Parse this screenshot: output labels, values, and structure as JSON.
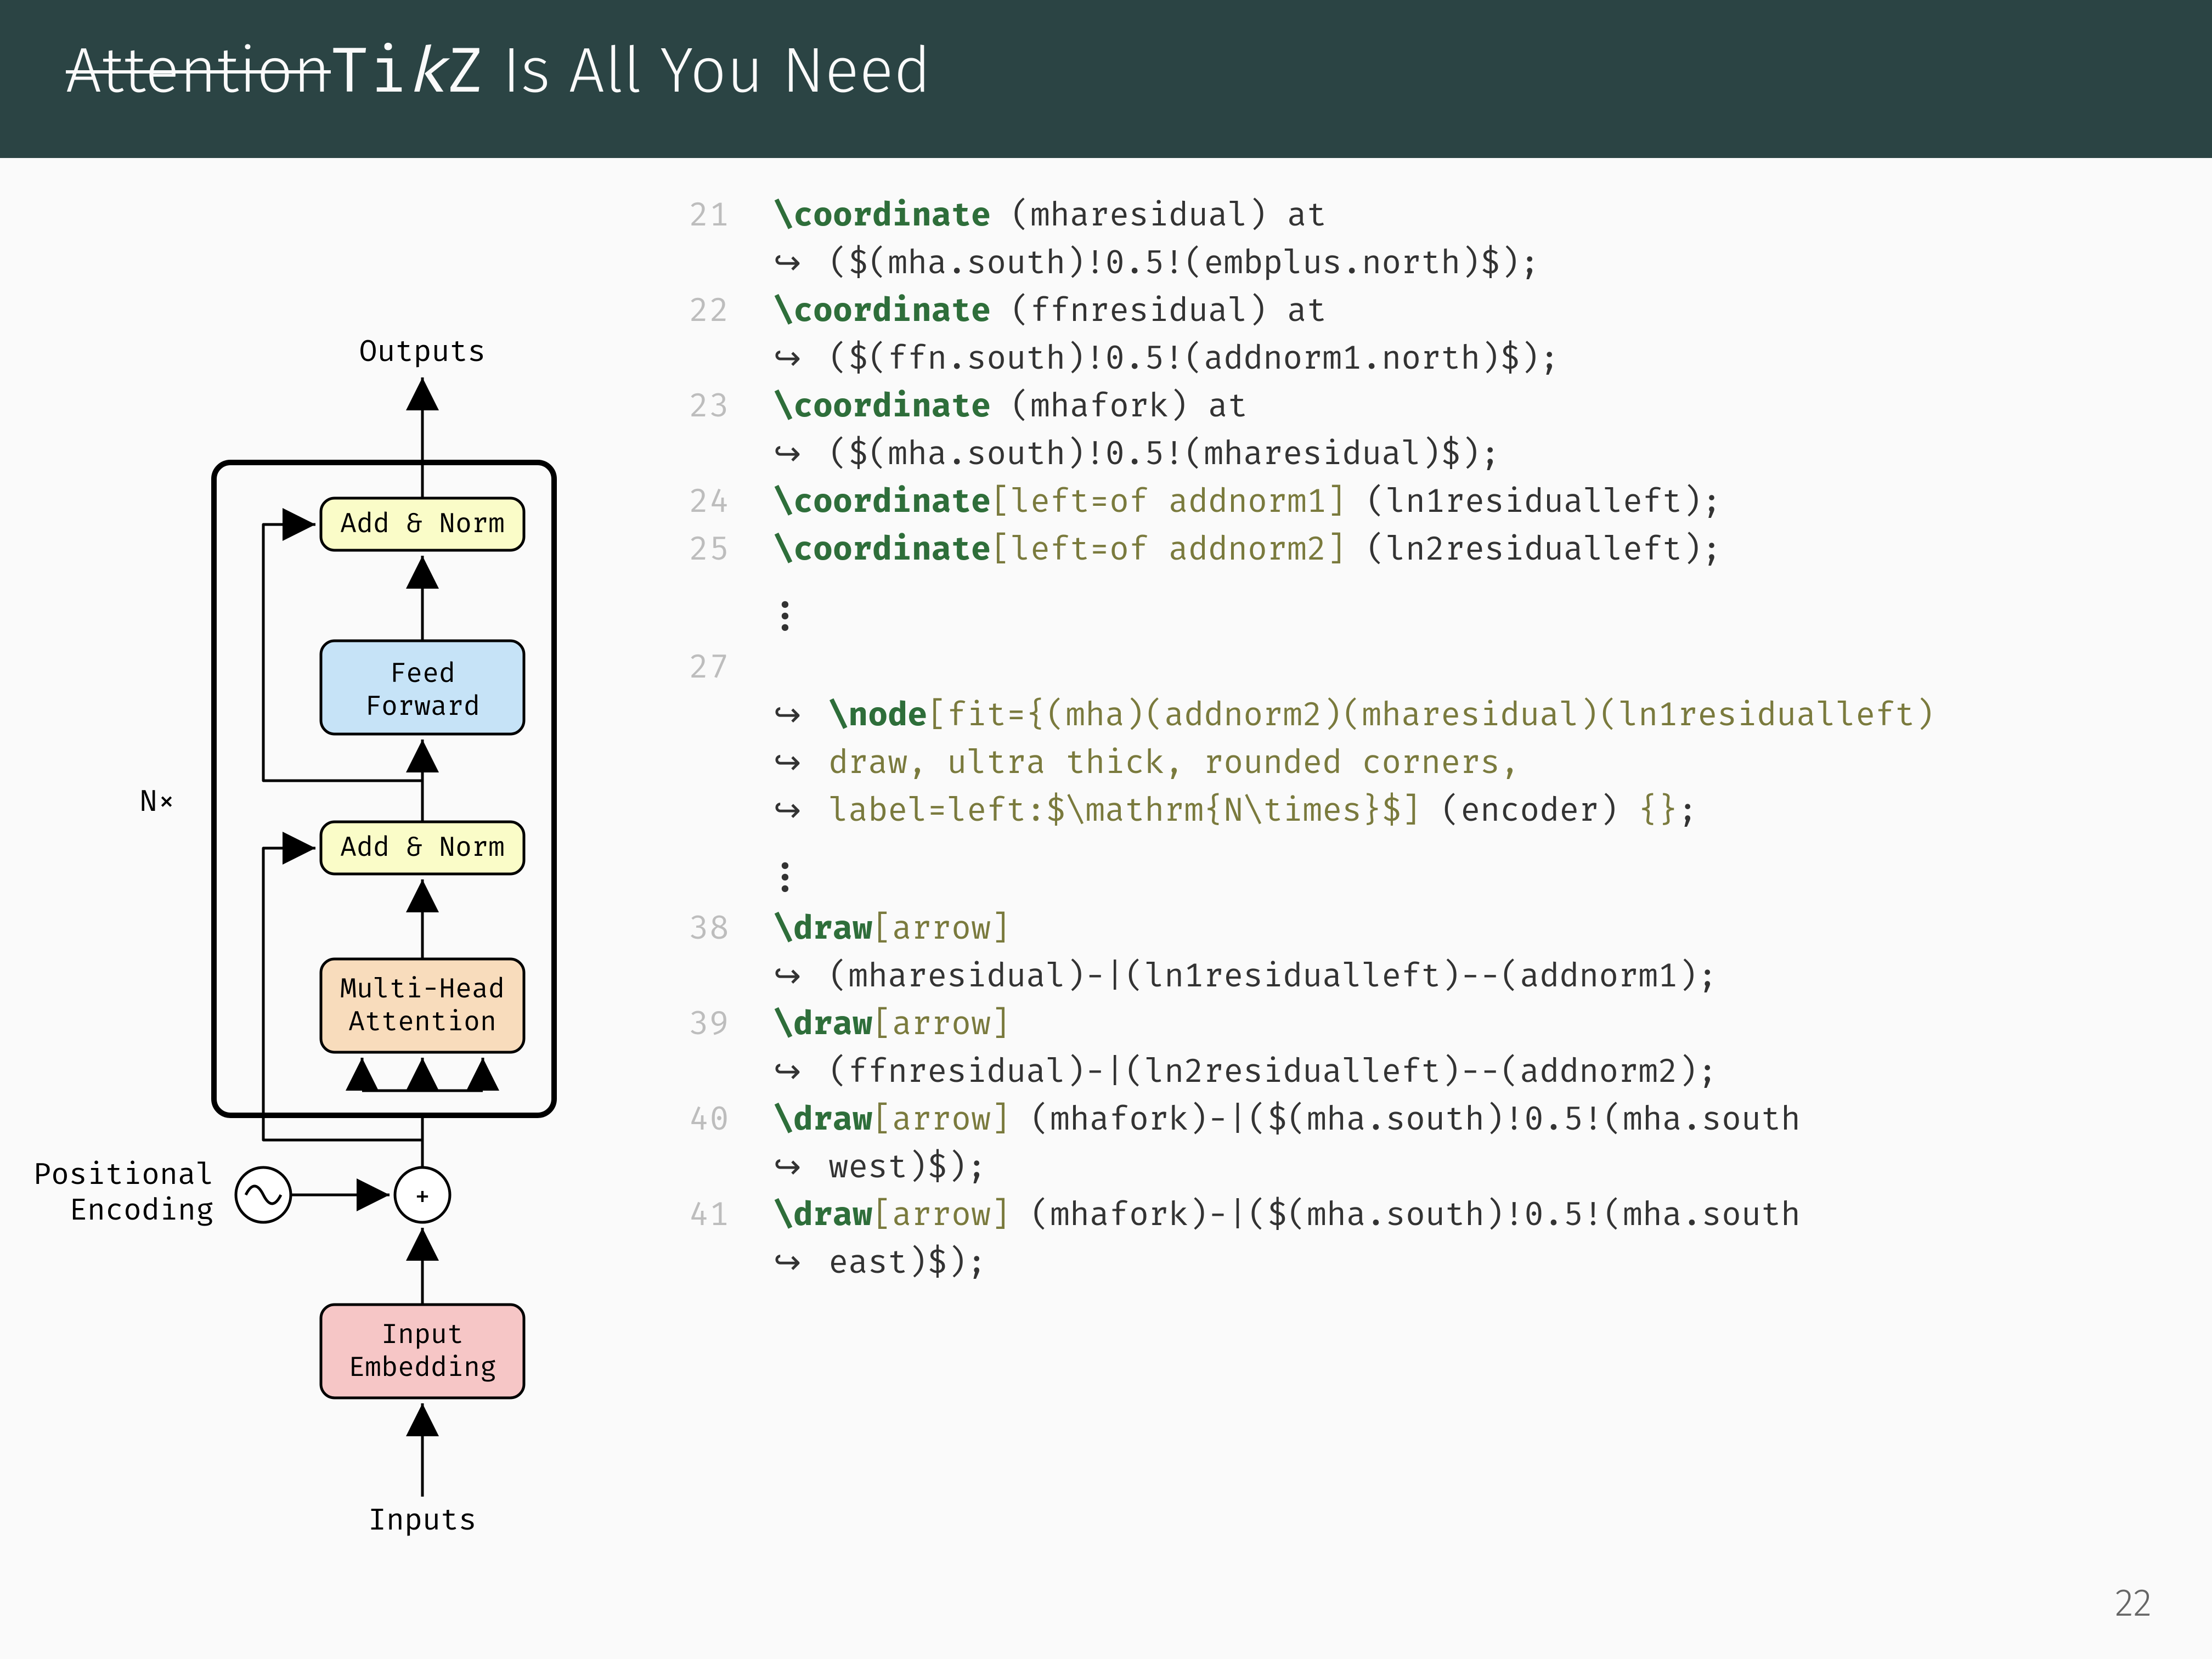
{
  "title": {
    "strike": "Attention",
    "tikz_pre": "Ti",
    "tikz_k": "k",
    "tikz_post": "Z",
    "rest": " Is All You Need"
  },
  "diagram": {
    "outputs": "Outputs",
    "addnorm2": "Add & Norm",
    "ffn": "Feed Forward",
    "addnorm1": "Add & Norm",
    "mha": "Multi-Head Attention",
    "plus": "+",
    "posenc": "Positional Encoding",
    "inputemb": "Input Embedding",
    "inputs": "Inputs",
    "nx": "N×"
  },
  "lines": {
    "l21a": "\\coordinate",
    "l21b": " (mharesidual) at",
    "l21c": "($(mha.south)!0.5!(embplus.north)$);",
    "l22a": "\\coordinate",
    "l22b": " (ffnresidual) at",
    "l22c": "($(ffn.south)!0.5!(addnorm1.north)$);",
    "l23a": "\\coordinate",
    "l23b": " (mhafork) at",
    "l23c": "($(mha.south)!0.5!(mharesidual)$);",
    "l24a": "\\coordinate",
    "l24b": "[left=of addnorm1]",
    "l24c": " (ln1residualleft);",
    "l25a": "\\coordinate",
    "l25b": "[left=of addnorm2]",
    "l25c": " (ln2residualleft);",
    "l27a": "\\node",
    "l27b": "[fit={(mha)(addnorm2)(mharesidual)(ln1residualleft)",
    "l27c": "draw, ultra thick, rounded corners,",
    "l27d": "label=left:$\\mathrm{N\\times}$]",
    "l27e": " (encoder) ",
    "l27f": "{}",
    "l27g": ";",
    "l38a": "\\draw",
    "l38b": "[arrow]",
    "l38c": "(mharesidual)-|(ln1residualleft)--(addnorm1);",
    "l39a": "\\draw",
    "l39b": "[arrow]",
    "l39c": "(ffnresidual)-|(ln2residualleft)--(addnorm2);",
    "l40a": "\\draw",
    "l40b": "[arrow]",
    "l40c": " (mhafork)-|($(mha.south)!0.5!(mha.south",
    "l40d": "west)$);",
    "l41a": "\\draw",
    "l41b": "[arrow]",
    "l41c": " (mhafork)-|($(mha.south)!0.5!(mha.south",
    "l41d": "east)$);"
  },
  "linenums": {
    "n21": "21",
    "n22": "22",
    "n23": "23",
    "n24": "24",
    "n25": "25",
    "n27": "27",
    "n38": "38",
    "n39": "39",
    "n40": "40",
    "n41": "41"
  },
  "page": "22",
  "hook": "↪   "
}
